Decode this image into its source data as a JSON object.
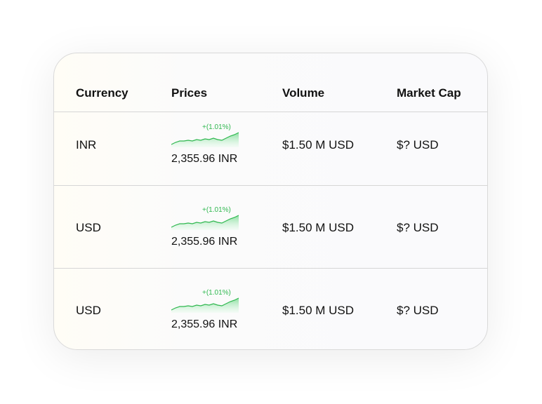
{
  "table": {
    "headers": {
      "currency": "Currency",
      "prices": "Prices",
      "volume": "Volume",
      "market_cap": "Market Cap"
    },
    "rows": [
      {
        "currency": "INR",
        "change": "+(1.01%)",
        "price": "2,355.96 INR",
        "volume": "$1.50 M USD",
        "market_cap": "$? USD"
      },
      {
        "currency": "USD",
        "change": "+(1.01%)",
        "price": "2,355.96 INR",
        "volume": "$1.50 M USD",
        "market_cap": "$? USD"
      },
      {
        "currency": "USD",
        "change": "+(1.01%)",
        "price": "2,355.96 INR",
        "volume": "$1.50 M USD",
        "market_cap": "$? USD"
      }
    ]
  },
  "colors": {
    "positive": "#2fb84f",
    "sparkline_fill": "#c9f0d2"
  }
}
